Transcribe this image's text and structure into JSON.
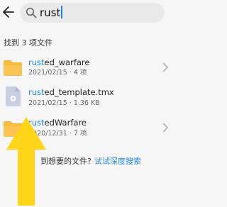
{
  "search": {
    "query": "rust"
  },
  "result_count": "找到 3 项文件",
  "highlight_color": "#1e88e5",
  "folder_color": "#f7bb3b",
  "results": [
    {
      "type": "folder",
      "icon": "folder-icon",
      "highlight": "rust",
      "rest": "ed_warfare",
      "meta": "2021/02/15 · 4 项"
    },
    {
      "type": "file",
      "icon": "tmx-file-icon",
      "highlight": "rust",
      "rest": "ed_template.tmx",
      "meta": "2021/02/15 · 1.36 KB"
    },
    {
      "type": "folder",
      "icon": "folder-icon",
      "highlight": "rust",
      "rest": "edWarfare",
      "meta": "2020/12/31 · 7 项"
    }
  ],
  "footer": {
    "prompt": "到想要的文件?",
    "link": "试试深度搜索"
  },
  "annotation": {
    "icon": "up-arrow-icon",
    "color": "#ffd51a"
  }
}
